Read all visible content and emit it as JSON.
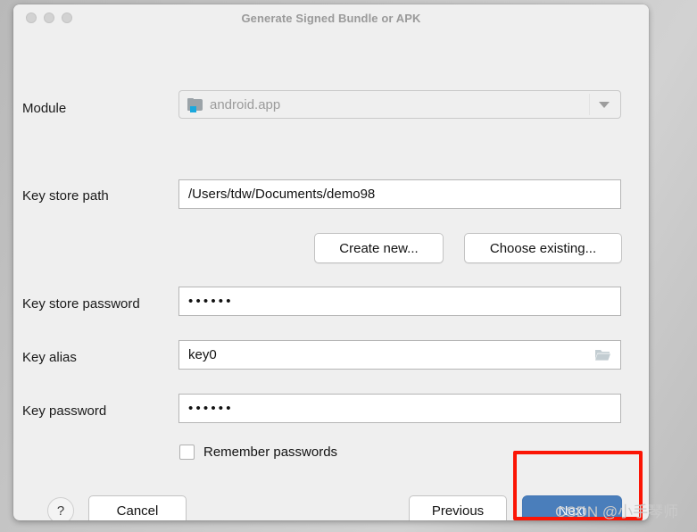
{
  "window": {
    "title": "Generate Signed Bundle or APK",
    "traffic_lights": [
      "close-button",
      "minimize-button",
      "zoom-button"
    ]
  },
  "form": {
    "module": {
      "label": "Module",
      "value": "android.app",
      "icon": "module-folder-icon",
      "dropdown_icon": "chevron-down-icon"
    },
    "key_store_path": {
      "label": "Key store path",
      "value": "/Users/tdw/Documents/demo98"
    },
    "keystore_buttons": {
      "create_new": "Create new...",
      "choose_existing": "Choose existing..."
    },
    "key_store_password": {
      "label": "Key store password",
      "value": "••••••"
    },
    "key_alias": {
      "label": "Key alias",
      "value": "key0",
      "browse_icon": "open-folder-icon"
    },
    "key_password": {
      "label": "Key password",
      "value": "••••••"
    },
    "remember_passwords": {
      "label": "Remember passwords",
      "checked": false
    }
  },
  "footer": {
    "help": "?",
    "cancel": "Cancel",
    "previous": "Previous",
    "next": "Next"
  },
  "annotation": {
    "target": "Next",
    "color": "#fb1505"
  },
  "watermark": {
    "text": "CSDN @小手琴师"
  },
  "colors": {
    "window_background": "#efefef",
    "primary_button": "#4a7ebb",
    "annotation_red": "#fb1505",
    "module_icon_accent": "#1aa8dd",
    "title_text": "#9a9a9a"
  }
}
